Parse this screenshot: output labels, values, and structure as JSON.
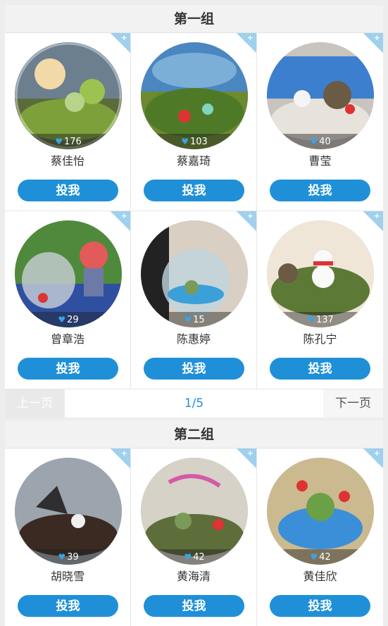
{
  "group1": {
    "title": "第一组",
    "entries": [
      {
        "name": "蔡佳怡",
        "likes": "176"
      },
      {
        "name": "蔡嘉琦",
        "likes": "103"
      },
      {
        "name": "曹莹",
        "likes": "40"
      },
      {
        "name": "曾章浩",
        "likes": "29"
      },
      {
        "name": "陈惠婷",
        "likes": "15"
      },
      {
        "name": "陈孔宁",
        "likes": "137"
      }
    ],
    "pager": {
      "prev": "上一页",
      "page": "1/5",
      "next": "下一页"
    }
  },
  "group2": {
    "title": "第二组",
    "entries": [
      {
        "name": "胡晓雪",
        "likes": "39"
      },
      {
        "name": "黄海清",
        "likes": "42"
      },
      {
        "name": "黄佳欣",
        "likes": "42"
      }
    ]
  },
  "vote_label": "投我",
  "corner_badge": "+",
  "heart_icon": "heart-icon",
  "colors": {
    "accent": "#1f90d8",
    "corner": "#9fd0ee",
    "heart": "#3aa3e3"
  }
}
